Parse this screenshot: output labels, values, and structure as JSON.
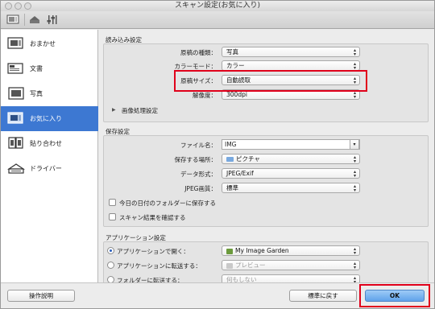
{
  "window": {
    "title": "スキャン設定(お気に入り)"
  },
  "toolbar": {
    "icons": [
      "scan-settings-icon",
      "scanner-icon",
      "general-settings-icon"
    ]
  },
  "sidebar": {
    "items": [
      {
        "label": "おまかせ",
        "icon": "auto-scan-icon",
        "selected": false
      },
      {
        "label": "文書",
        "icon": "document-icon",
        "selected": false
      },
      {
        "label": "写真",
        "icon": "photo-icon",
        "selected": false
      },
      {
        "label": "お気に入り",
        "icon": "favorites-icon",
        "selected": true
      },
      {
        "label": "貼り合わせ",
        "icon": "stitch-icon",
        "selected": false
      },
      {
        "label": "ドライバー",
        "icon": "driver-icon",
        "selected": false
      }
    ]
  },
  "read_settings": {
    "title": "読み込み設定",
    "document_type": {
      "label": "原稿の種類：",
      "value": "写真"
    },
    "color_mode": {
      "label": "カラーモード：",
      "value": "カラー"
    },
    "document_size": {
      "label": "原稿サイズ：",
      "value": "自動読取"
    },
    "resolution": {
      "label": "解像度：",
      "value": "300dpi"
    },
    "image_processing": {
      "label": "画像処理設定"
    }
  },
  "save_settings": {
    "title": "保存設定",
    "file_name": {
      "label": "ファイル名：",
      "value": "IMG"
    },
    "save_location": {
      "label": "保存する場所：",
      "value": "ピクチャ"
    },
    "data_format": {
      "label": "データ形式：",
      "value": "JPEG/Exif"
    },
    "jpeg_quality": {
      "label": "JPEG画質：",
      "value": "標準"
    },
    "save_in_date_folder": {
      "label": "今日の日付のフォルダーに保存する",
      "checked": false
    },
    "confirm_results": {
      "label": "スキャン結果を確認する",
      "checked": false
    }
  },
  "app_settings": {
    "title": "アプリケーション設定",
    "open_with_app": {
      "label": "アプリケーションで開く：",
      "value": "My Image Garden",
      "selected": true
    },
    "send_to_app": {
      "label": "アプリケーションに転送する：",
      "value": "プレビュー",
      "selected": false
    },
    "send_to_folder": {
      "label": "フォルダーに転送する：",
      "value": "何もしない",
      "selected": false
    }
  },
  "footer": {
    "instructions_label": "操作説明",
    "defaults_label": "標準に戻す",
    "ok_label": "OK"
  },
  "colors": {
    "selection": "#3d78d2",
    "highlight": "#e0001b",
    "primary_button": "#5fa2ea"
  }
}
